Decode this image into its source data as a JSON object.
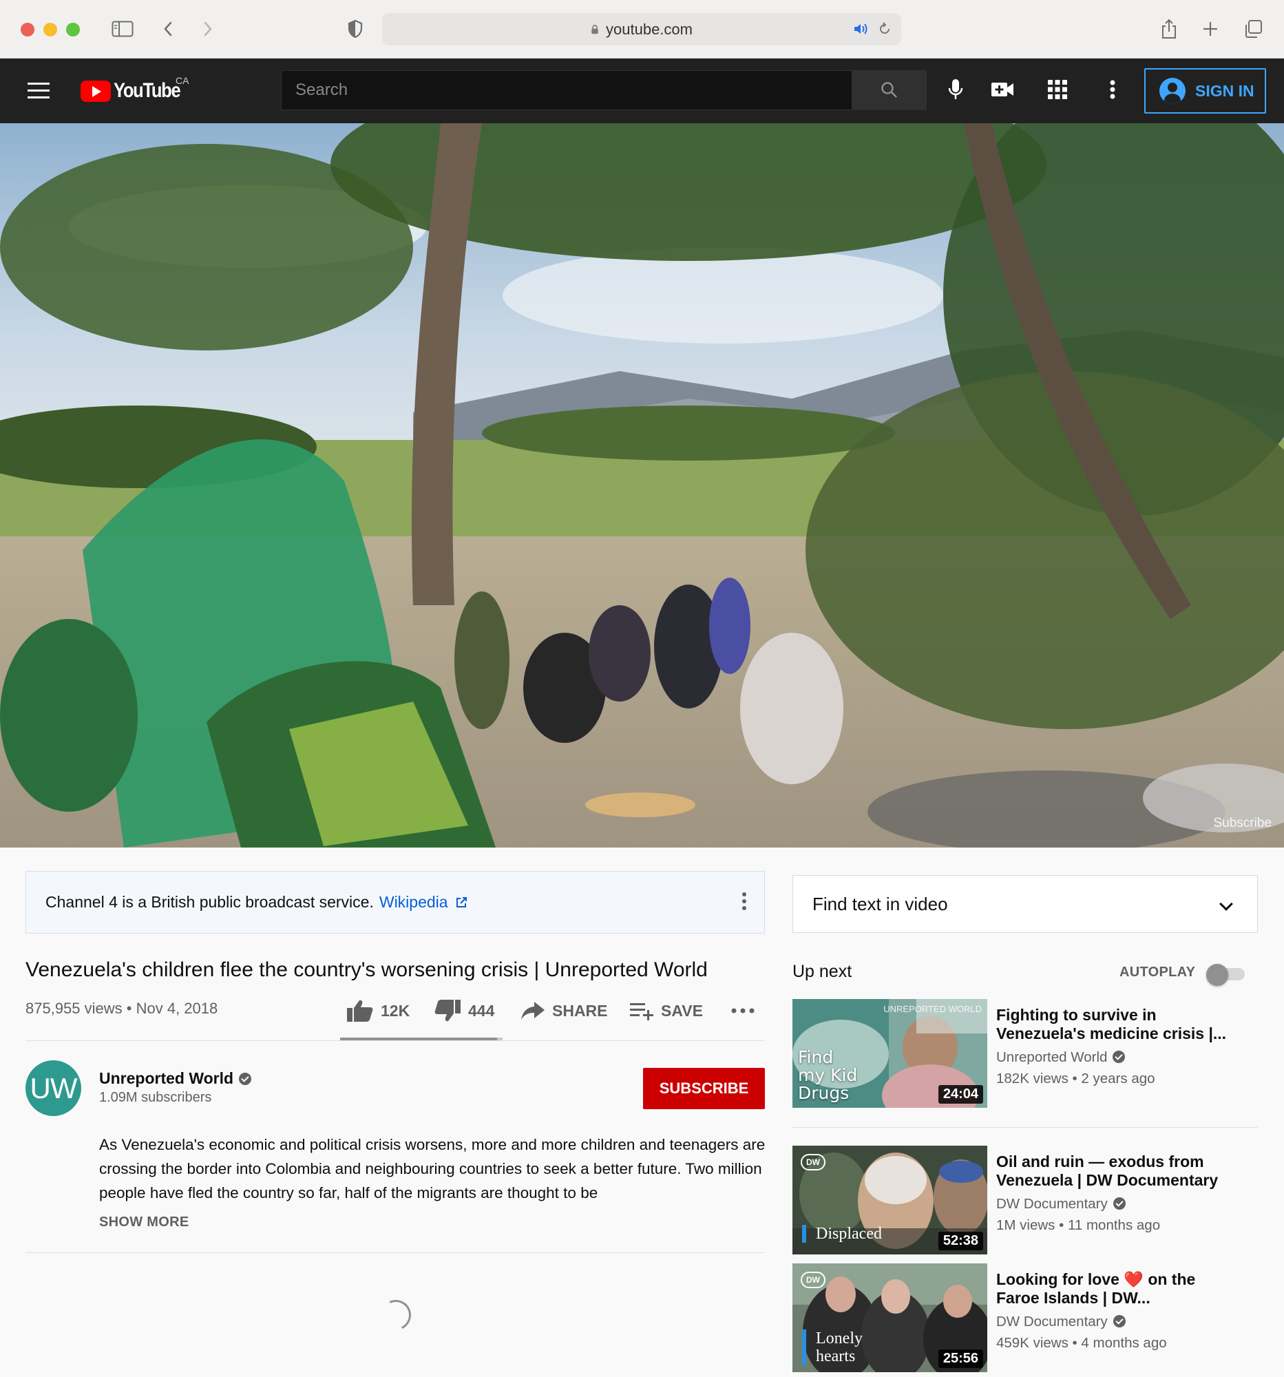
{
  "browser": {
    "url": "youtube.com"
  },
  "header": {
    "logo_text": "YouTube",
    "country": "CA",
    "search_placeholder": "Search",
    "sign_in_label": "SIGN IN"
  },
  "video": {
    "watermark": "Subscribe",
    "title": "Venezuela's children flee the country's worsening crisis | Unreported World",
    "views": "875,955 views",
    "date": "Nov 4, 2018",
    "meta_separator": "•",
    "likes": "12K",
    "dislikes": "444",
    "like_ratio": 0.964,
    "share_label": "SHARE",
    "save_label": "SAVE"
  },
  "info_panel": {
    "text": "Channel 4 is a British public broadcast service.",
    "link": "Wikipedia"
  },
  "channel": {
    "avatar_text": "UW",
    "name": "Unreported World",
    "subscribers": "1.09M subscribers",
    "subscribe_label": "SUBSCRIBE"
  },
  "description": {
    "text": "As Venezuela's economic and political crisis worsens, more and more children and teenagers are crossing the border into Colombia and neighbouring countries to seek a better future. Two million people have fled the country so far, half of the migrants are thought to be",
    "show_more": "SHOW MORE"
  },
  "sidebar": {
    "find_text": "Find text in video",
    "up_next": "Up next",
    "autoplay": "AUTOPLAY",
    "autoplay_on": false,
    "recommendations": [
      {
        "title": "Fighting to survive in Venezuela's medicine crisis |...",
        "channel": "Unreported World",
        "meta": "182K views • 2 years ago",
        "duration": "24:04",
        "thumb_text": [
          "Find",
          "my Kid",
          "Drugs"
        ],
        "thumb_corner": "UNREPORTED WORLD"
      },
      {
        "title": "Oil and ruin — exodus from Venezuela | DW Documentary",
        "channel": "DW Documentary",
        "meta": "1M views • 11 months ago",
        "duration": "52:38",
        "thumb_text": [
          "Displaced"
        ],
        "badge": "DW"
      },
      {
        "title_before": "Looking for love",
        "title_emoji": "❤️",
        "title_after": "on the Faroe Islands | DW...",
        "channel": "DW Documentary",
        "meta": "459K views • 4 months ago",
        "duration": "25:56",
        "thumb_text": [
          "Lonely",
          "hearts"
        ],
        "badge": "DW"
      }
    ]
  },
  "colors": {
    "header_bg": "#212121",
    "brand_red": "#ff0000",
    "subscribe_red": "#cc0000",
    "link_blue": "#065fd4",
    "signin_blue": "#3ea6ff"
  }
}
